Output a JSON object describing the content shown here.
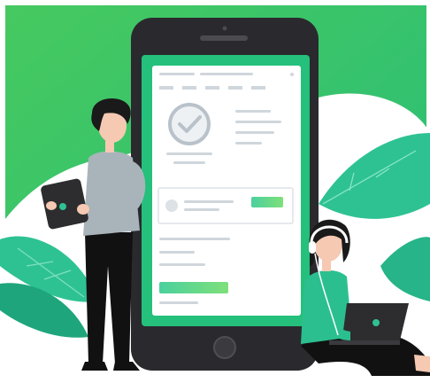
{
  "colors": {
    "bg_green_top": "#39c463",
    "bg_green_bottom": "#2fbf71",
    "teal": "#2ec293",
    "teal_dark": "#1b9a78",
    "white_blob": "#ffffff",
    "phone_body": "#2a2a2e",
    "phone_screen": "#24c07c",
    "card_bg": "#ffffff",
    "line_gray": "#cfd6dc",
    "check_gray": "#b9c2ca",
    "green_button": "#4fd49a",
    "skin": "#f6c9b2",
    "hair": "#1a1a1a",
    "shirt_gray": "#a9b4ba",
    "pants_black": "#111111",
    "woman_shirt": "#2bbf8f",
    "laptop": "#2d2d30"
  },
  "icons": {
    "check": "checkmark-circle-icon",
    "home_button": "home-button-icon",
    "headphones": "headphones-icon"
  }
}
